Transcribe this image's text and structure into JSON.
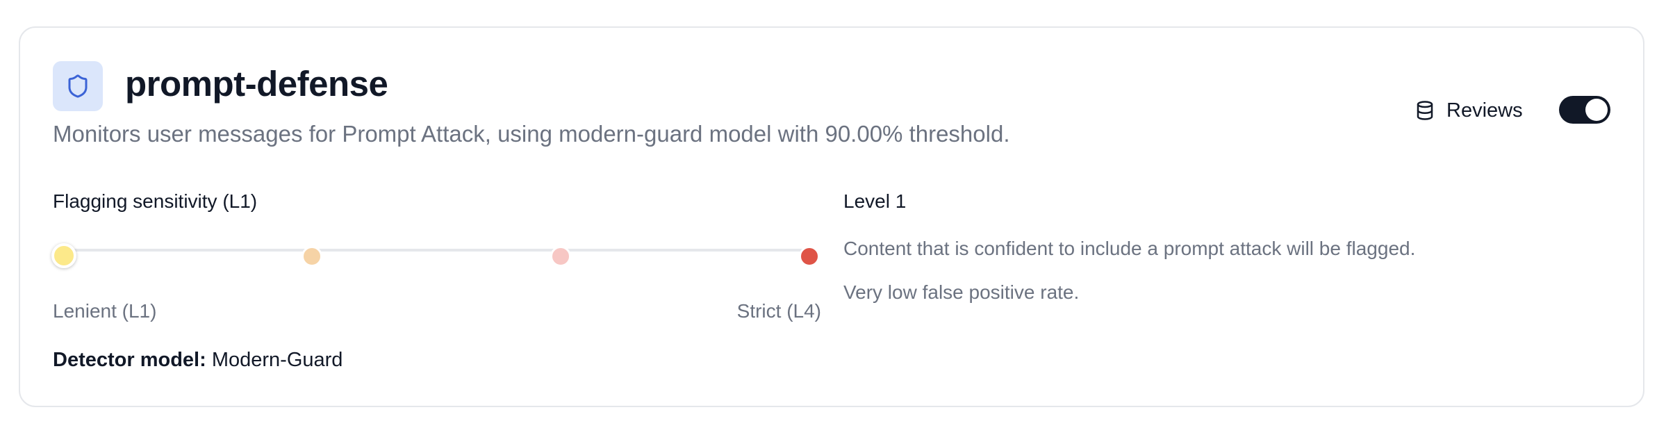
{
  "guard": {
    "name": "prompt-defense",
    "icon": "shield-icon",
    "description": "Monitors user messages for Prompt Attack, using modern-guard model with 90.00% threshold."
  },
  "reviews": {
    "icon": "database-icon",
    "label": "Reviews",
    "enabled": true
  },
  "sensitivity": {
    "label": "Flagging sensitivity (L1)",
    "selected_level": 1,
    "levels": [
      {
        "level": 1,
        "color": "#fce98a"
      },
      {
        "level": 2,
        "color": "#f6d3a6"
      },
      {
        "level": 3,
        "color": "#f7c7c4"
      },
      {
        "level": 4,
        "color": "#df5447"
      }
    ],
    "min_label": "Lenient (L1)",
    "max_label": "Strict (L4)"
  },
  "detector": {
    "label": "Detector model:",
    "value": "Modern-Guard"
  },
  "level_info": {
    "title": "Level 1",
    "lines": [
      "Content that is confident to include a prompt attack will be flagged.",
      "Very low false positive rate."
    ]
  },
  "colors": {
    "accent_dark": "#111827",
    "icon_blue": "#3b63d6",
    "icon_bg": "#dbe6fb",
    "muted_text": "#6b7280"
  }
}
